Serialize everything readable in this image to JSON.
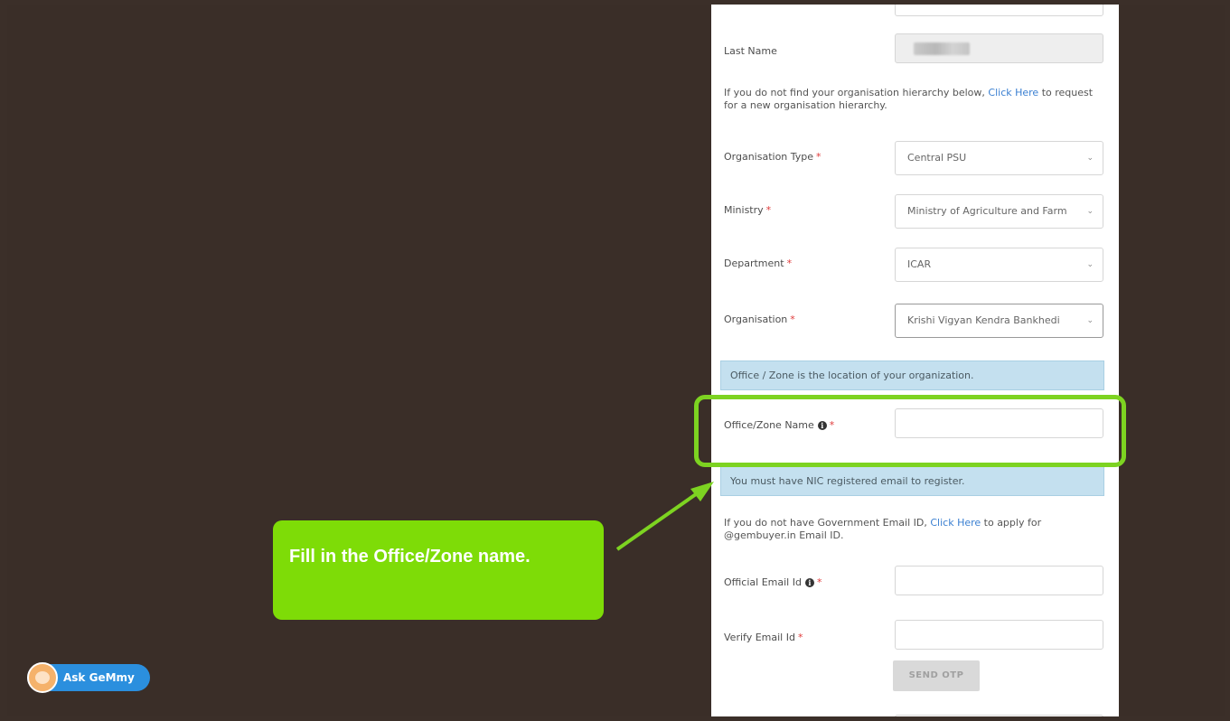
{
  "form": {
    "last_name_label": "Last Name",
    "hierarchy_note_pre": "If you do not find your organisation hierarchy below, ",
    "hierarchy_link": "Click Here",
    "hierarchy_note_post": " to request for a new organisation hierarchy.",
    "org_type": {
      "label": "Organisation Type",
      "value": "Central PSU"
    },
    "ministry": {
      "label": "Ministry",
      "value": "Ministry of Agriculture and Farm"
    },
    "department": {
      "label": "Department",
      "value": "ICAR"
    },
    "organisation": {
      "label": "Organisation",
      "value": "Krishi Vigyan Kendra Bankhedi"
    },
    "office_notice": "Office / Zone is the location of your organization.",
    "office_zone_label": "Office/Zone Name",
    "nic_notice": "You must have NIC registered email to register.",
    "gov_email_pre": "If you do not have Government Email ID, ",
    "gov_email_link": "Click Here",
    "gov_email_post": " to apply for @gembuyer.in Email ID.",
    "official_email_label": "Official Email Id",
    "verify_email_label": "Verify Email Id",
    "send_otp": "SEND OTP",
    "required_mark": "*",
    "chevron": "⌄",
    "info_glyph": "i"
  },
  "callout": {
    "text": "Fill in the Office/Zone name."
  },
  "assistant": {
    "label": "Ask GeMmy"
  },
  "colors": {
    "highlight": "#7dd321",
    "callout": "#7edc07",
    "link": "#3a7fd1",
    "notice": "#c4e0ef",
    "gemmy": "#2b8fde"
  }
}
